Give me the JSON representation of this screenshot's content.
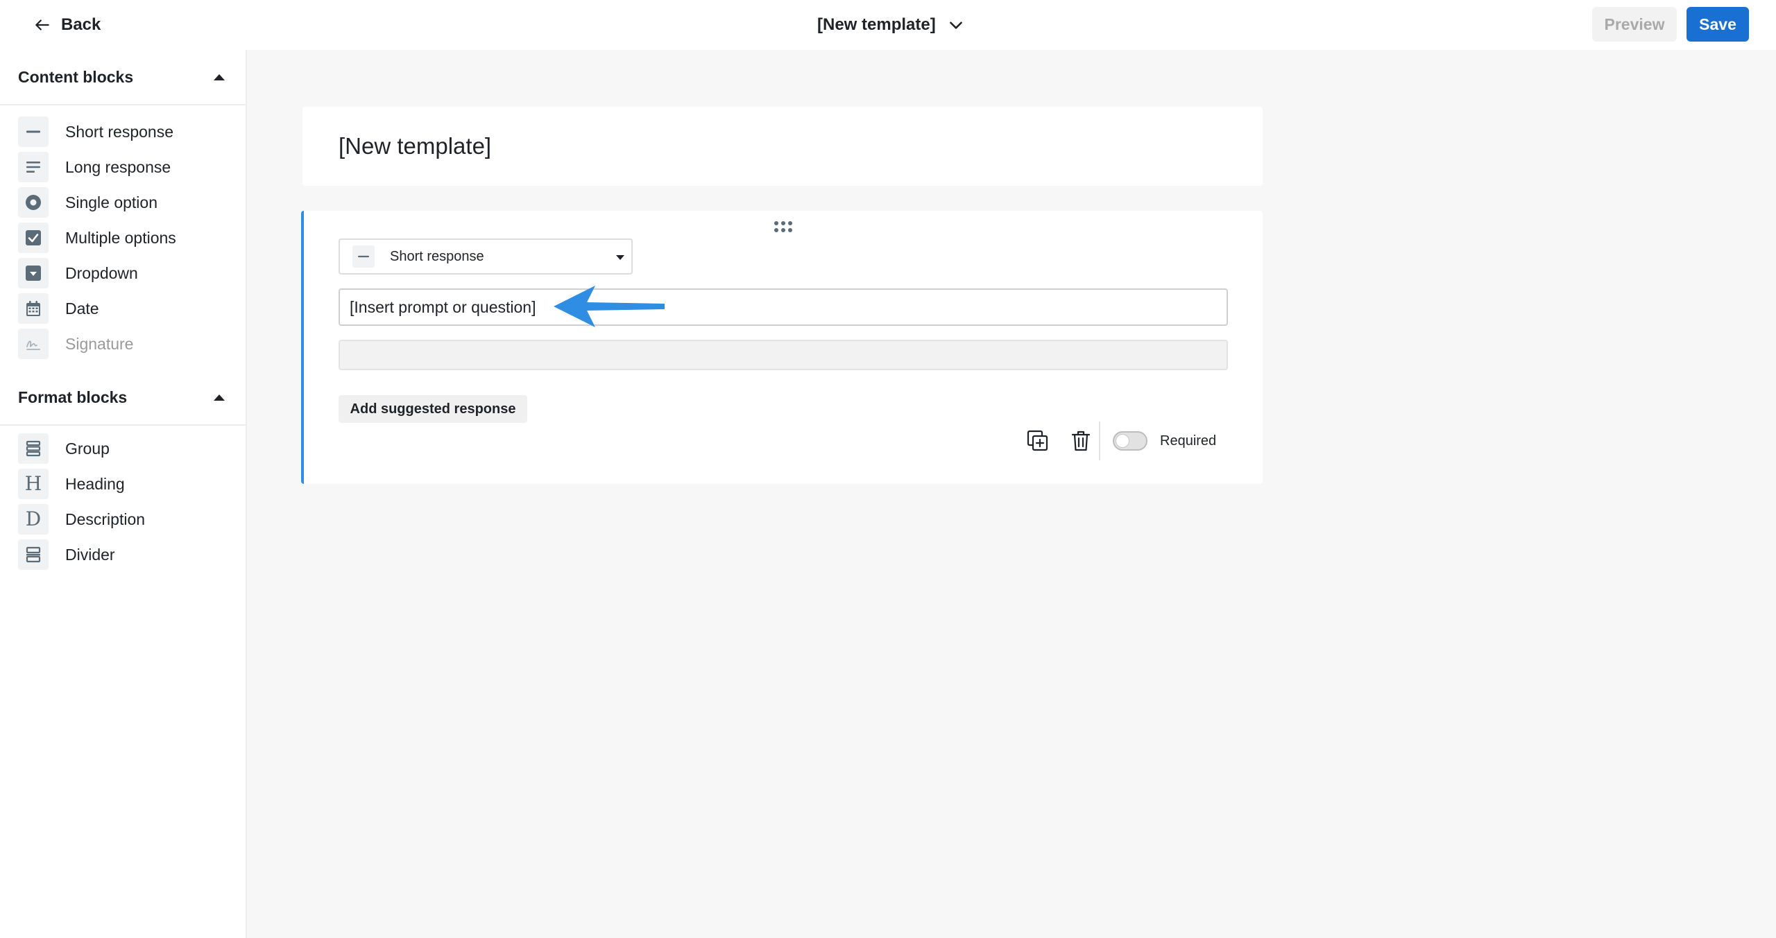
{
  "header": {
    "back_label": "Back",
    "template_title": "[New template]",
    "preview_label": "Preview",
    "save_label": "Save"
  },
  "sidebar": {
    "content_blocks": {
      "title": "Content blocks",
      "items": [
        {
          "label": "Short response",
          "icon": "short-response-icon"
        },
        {
          "label": "Long response",
          "icon": "long-response-icon"
        },
        {
          "label": "Single option",
          "icon": "radio-icon"
        },
        {
          "label": "Multiple options",
          "icon": "checkbox-icon"
        },
        {
          "label": "Dropdown",
          "icon": "dropdown-icon"
        },
        {
          "label": "Date",
          "icon": "calendar-icon"
        },
        {
          "label": "Signature",
          "icon": "signature-icon"
        }
      ]
    },
    "format_blocks": {
      "title": "Format blocks",
      "items": [
        {
          "label": "Group",
          "icon": "group-icon"
        },
        {
          "label": "Heading",
          "icon": "heading-icon"
        },
        {
          "label": "Description",
          "icon": "description-icon"
        },
        {
          "label": "Divider",
          "icon": "divider-icon"
        }
      ]
    }
  },
  "main": {
    "template_name": "[New template]",
    "question": {
      "type_label": "Short response",
      "prompt_value": "[Insert prompt or question]",
      "suggest_label": "Add suggested response",
      "required_label": "Required",
      "required_on": false
    }
  },
  "colors": {
    "primary": "#1a6fd3",
    "active_border": "#2f8de4",
    "annotation_arrow": "#2f8de4",
    "icon_gray": "#5b6b78"
  }
}
